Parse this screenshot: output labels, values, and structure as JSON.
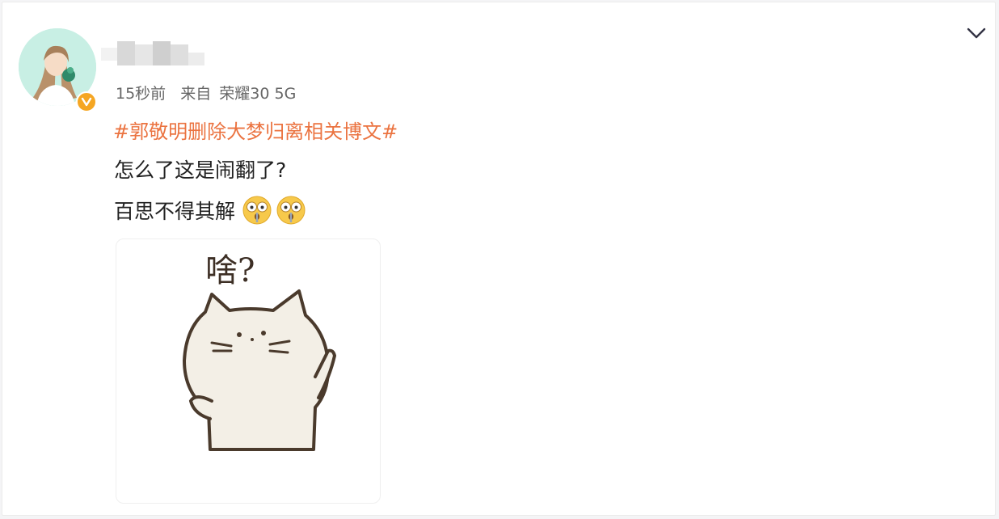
{
  "post": {
    "meta": {
      "time": "15秒前",
      "source_prefix": "来自",
      "source_device": "荣耀30 5G"
    },
    "hashtag": "#郭敬明删除大梦归离相关博文#",
    "lines": [
      "怎么了这是闹翻了?",
      "百思不得其解"
    ],
    "emojis": [
      "shocked-face-icon",
      "shocked-face-icon"
    ],
    "sticker": {
      "text": "啥?",
      "subject": "cat-icon"
    }
  },
  "colors": {
    "hashtag": "#eb7340",
    "verified_badge": "#f5a623",
    "avatar_bg": "#c8efe4",
    "text": "#222222",
    "meta": "#666666"
  }
}
